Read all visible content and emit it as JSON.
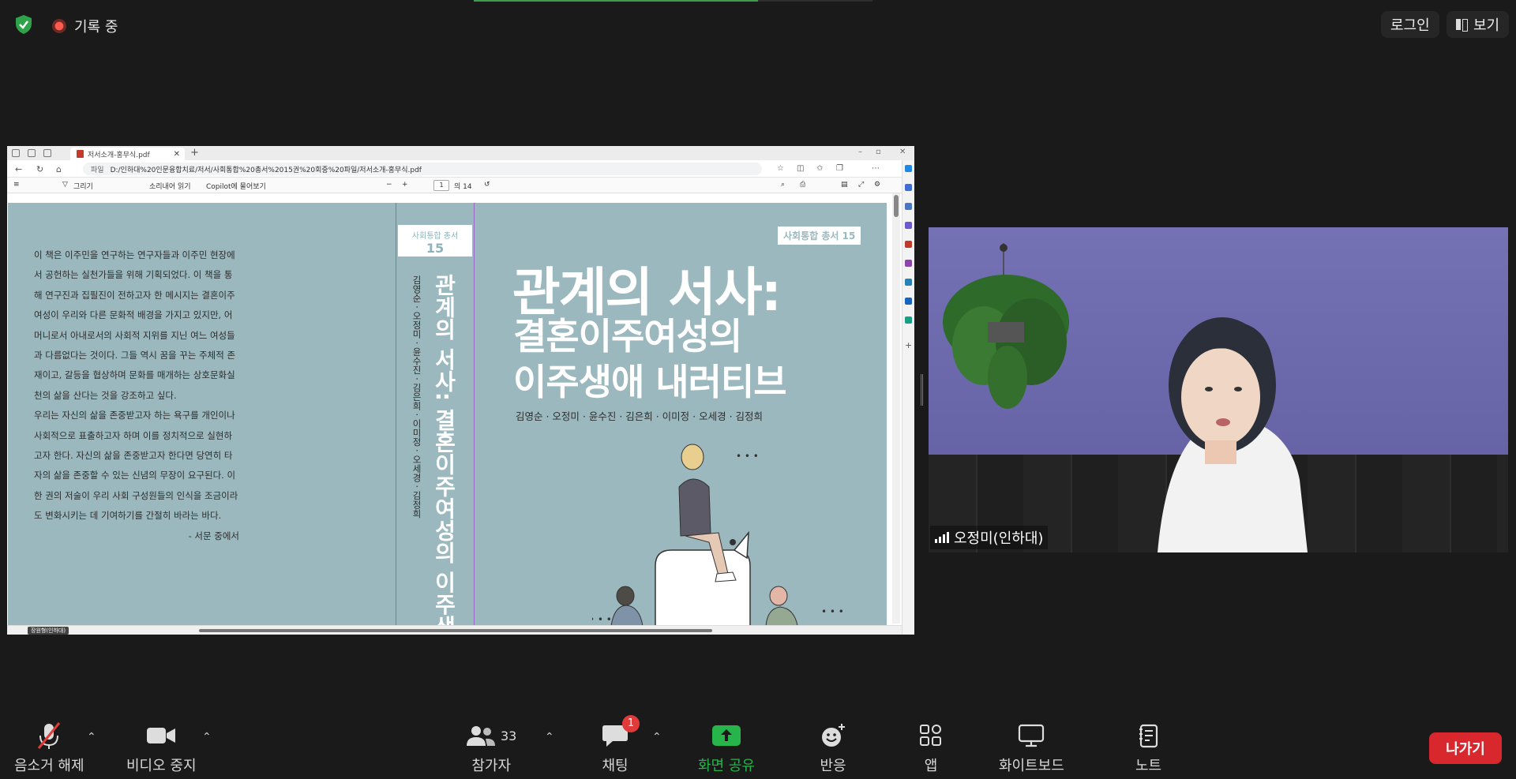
{
  "top": {
    "recording_label": "기록 중",
    "login_label": "로그인",
    "view_label": "보기"
  },
  "browser": {
    "tab_title": "저서소개-홍무식.pdf",
    "address_prefix": "파일",
    "address": "D:/인하대%20인문융합치료/저서/사회통합%20총서%2015권%20회중%20파일/저서소개-홍무식.pdf",
    "draw_label": "그리기",
    "read_aloud_label": "소리내어 읽기",
    "copilot_label": "Copilot에 물어보기",
    "page_current": "1",
    "page_total": "의 14",
    "hscroll_tip": "장원형(인하대)"
  },
  "book": {
    "back_paragraph1": "이 책은 이주민을 연구하는 연구자들과 이주민 현장에서 공헌하는 실천가들을 위해 기획되었다. 이 책을 통해 연구진과 집필진이 전하고자 한 메시지는 결혼이주여성이 우리와 다른 문화적 배경을 가지고 있지만, 어머니로서 아내로서의 사회적 지위를 지닌 여느 여성들과 다름없다는 것이다. 그들 역시 꿈을 꾸는 주체적 존재이고, 갈등을 협상하며 문화를 매개하는 상호문화실천의 삶을 산다는 것을 강조하고 싶다.",
    "back_paragraph2": "우리는 자신의 삶을 존중받고자 하는 욕구를 개인이나 사회적으로 표출하고자 하며 이를 정치적으로 실현하고자 한다. 자신의 삶을 존중받고자 한다면 당연히 타자의 삶을 존중할 수 있는 신념의 무장이 요구된다. 이 한 권의 저술이 우리 사회 구성원들의 인식을 조금이라도 변화시키는 데 기여하기를 간절히 바라는 바다.",
    "back_signature": "- 서문 중에서",
    "series_label": "사회통합 총서",
    "series_number": "15",
    "series_badge": "사회통합 총서 15",
    "spine_title": "관계의 서사: 결혼이주여성의 이주생애 내러티브",
    "spine_authors": "김영순 · 오정미 · 윤수진 · 김은희 · 이미정 · 오세경 · 김정희",
    "title_main": "관계의 서사:",
    "title_sub1": "결혼이주여성의",
    "title_sub2": "이주생애 내러티브",
    "authors": "김영순 · 오정미 · 윤수진 · 김은희 · 이미정 · 오세경 · 김정희",
    "bg_color": "#9ab8be"
  },
  "video": {
    "participant_name": "오정미(인하대)"
  },
  "toolbar": {
    "mute_label": "음소거 해제",
    "video_label": "비디오 중지",
    "participants_label": "참가자",
    "participants_count": "33",
    "chat_label": "채팅",
    "chat_badge": "1",
    "share_label": "화면 공유",
    "reactions_label": "반응",
    "apps_label": "앱",
    "whiteboard_label": "화이트보드",
    "notes_label": "노트",
    "leave_label": "나가기",
    "share_color": "#27b44a",
    "leave_color": "#d8282d"
  }
}
